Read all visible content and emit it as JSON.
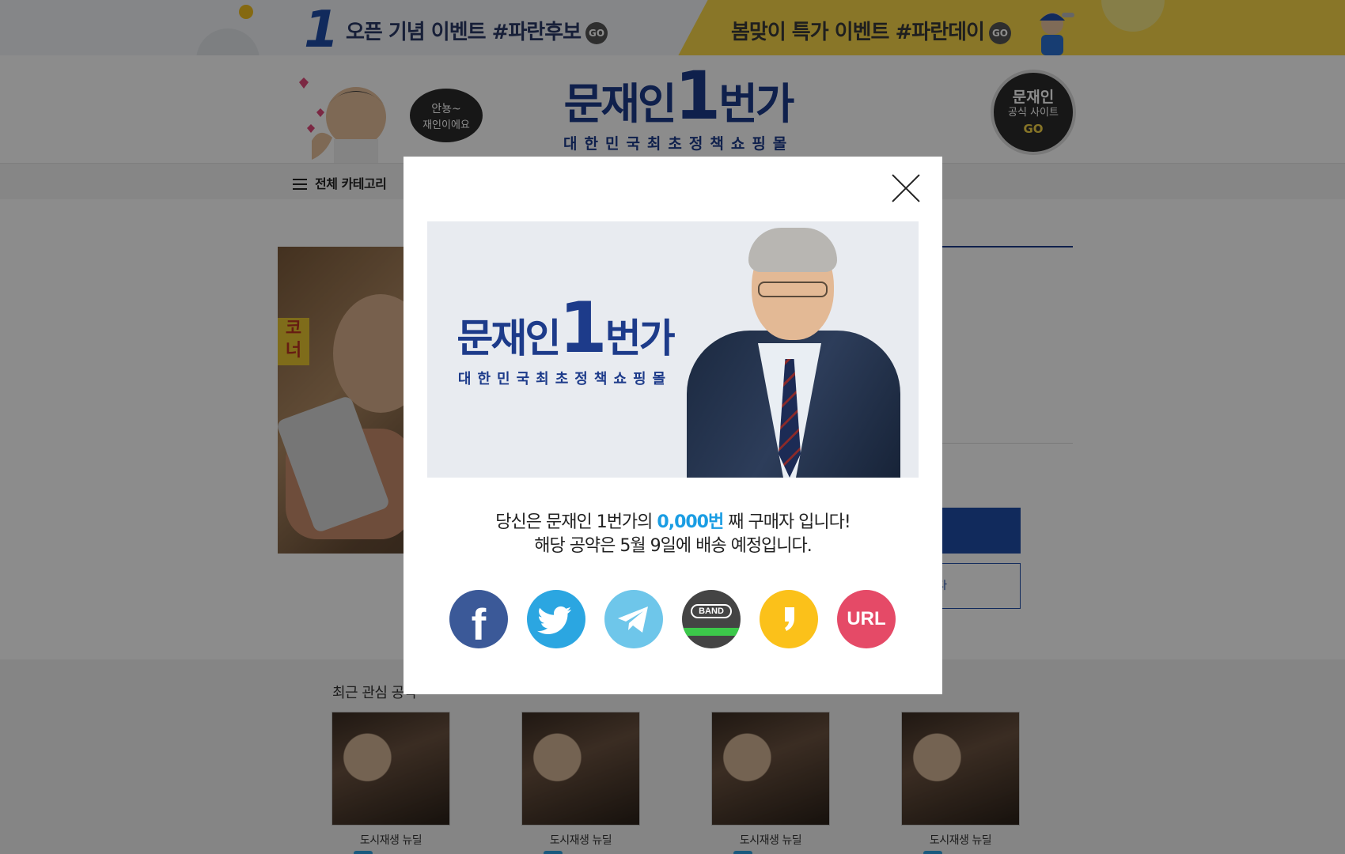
{
  "top_banners": {
    "left": {
      "number": "1",
      "text": "오픈 기념 이벤트 #파란후보",
      "go": "GO"
    },
    "right": {
      "text": "봄맞이 특가 이벤트 #파란데이",
      "go": "GO"
    }
  },
  "header": {
    "speech_bubble": "안뇽~ 재인이에요",
    "logo_main_prefix": "문재인",
    "logo_one": "1",
    "logo_main_suffix": "번가",
    "logo_sub": "대한민국최초정책쇼핑몰",
    "official_site": {
      "line1": "문재인",
      "line2": "공식 사이트",
      "line3": "GO"
    }
  },
  "nav": {
    "category_label": "전체 카테고리"
  },
  "product": {
    "sign_text": "코너",
    "share_hint": "다"
  },
  "recent": {
    "title": "최근 관심 공약",
    "items": [
      {
        "caption": "도시재생 뉴딜"
      },
      {
        "caption": "도시재생 뉴딜"
      },
      {
        "caption": "도시재생 뉴딜"
      },
      {
        "caption": "도시재생 뉴딜"
      }
    ]
  },
  "modal": {
    "banner_logo_prefix": "문재인",
    "banner_logo_one": "1",
    "banner_logo_suffix": "번가",
    "banner_logo_sub": "대한민국최초정책쇼핑몰",
    "line1_before": "당신은 문재인 1번가의 ",
    "line1_highlight": "0,000번",
    "line1_after": " 째 구매자 입니다!",
    "line2": "해당 공약은 5월 9일에 배송 예정입니다.",
    "share": {
      "facebook_glyph": "f",
      "band_label": "BAND",
      "url_label": "URL"
    }
  },
  "colors": {
    "brand_navy": "#1d3b8a",
    "highlight_blue": "#1a9de3",
    "facebook": "#3b5998",
    "twitter": "#2ba6e1",
    "telegram": "#6ec6ea",
    "band": "#444444",
    "kakao": "#fbc11a",
    "url": "#e54a67"
  }
}
